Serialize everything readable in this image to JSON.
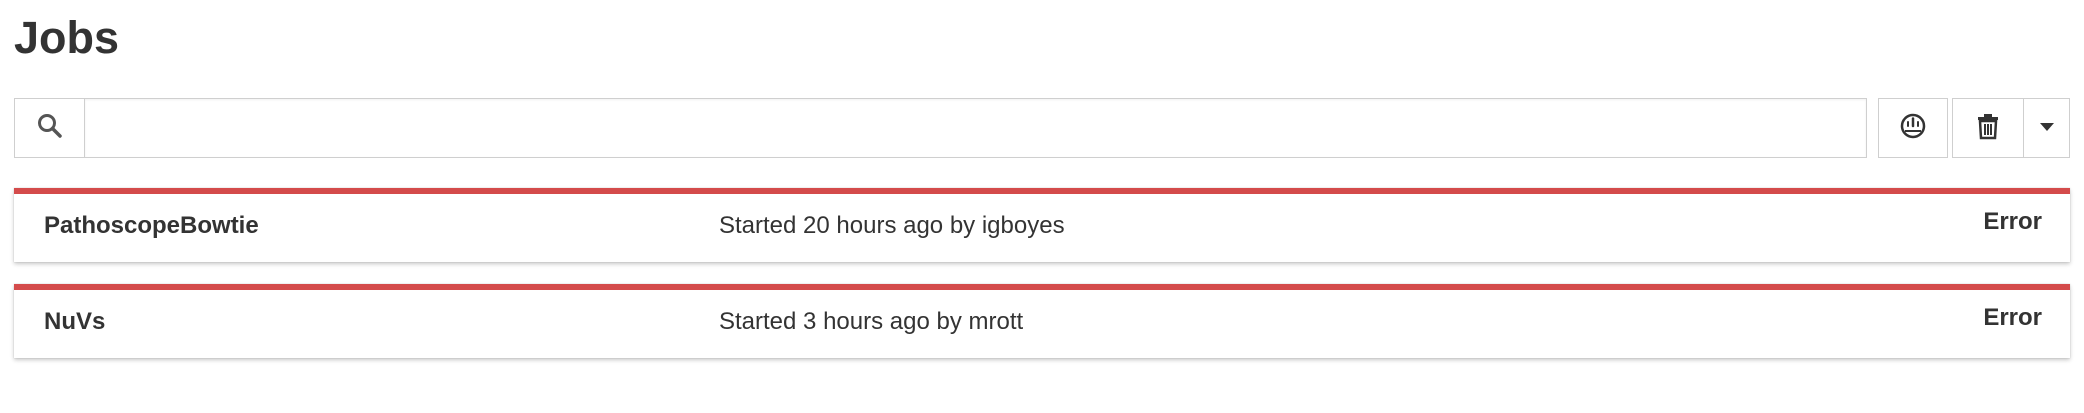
{
  "page": {
    "title": "Jobs"
  },
  "toolbar": {
    "search": {
      "value": "",
      "placeholder": "",
      "icon": "search-icon"
    },
    "buttons": [
      {
        "icon": "gauge-icon"
      },
      {
        "icon": "trash-icon"
      },
      {
        "icon": "caret-down-icon"
      }
    ]
  },
  "jobs": [
    {
      "name": "PathoscopeBowtie",
      "meta": "Started 20 hours ago by igboyes",
      "status": "Error"
    },
    {
      "name": "NuVs",
      "meta": "Started 3 hours ago by mrott",
      "status": "Error"
    }
  ],
  "colors": {
    "error_accent": "#d44b4b",
    "text": "#333333",
    "border": "#cfcfcf"
  }
}
